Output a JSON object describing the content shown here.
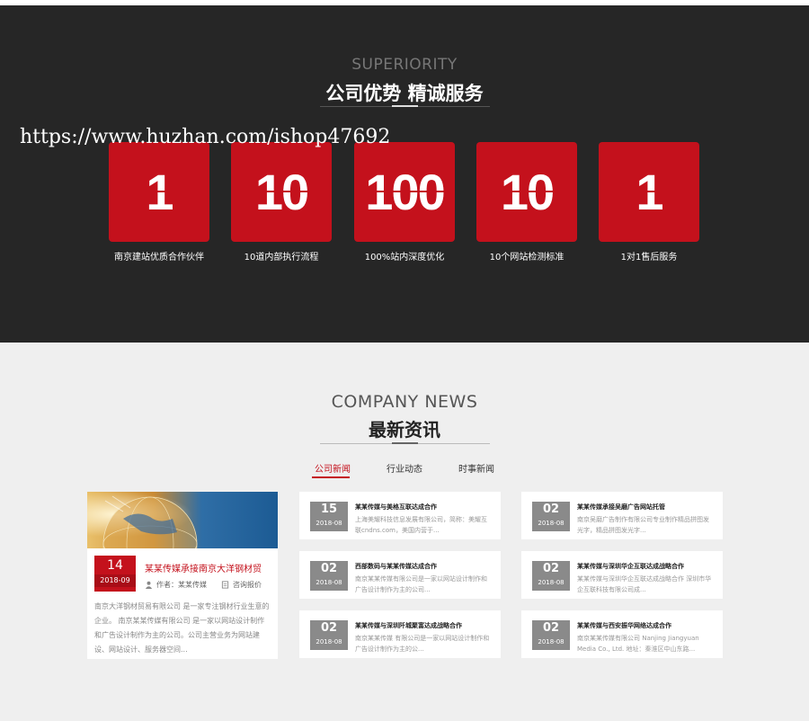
{
  "superiority": {
    "title_en": "SUPERIORITY",
    "title_cn": "公司优势  精诚服务",
    "watermark": "https://www.huzhan.com/ishop47692",
    "items": [
      {
        "number": "1",
        "label": "南京建站优质合作伙伴"
      },
      {
        "number": "10",
        "label": "10道内部执行流程"
      },
      {
        "number": "100",
        "label": "100%站内深度优化"
      },
      {
        "number": "10",
        "label": "10个网站检测标准"
      },
      {
        "number": "1",
        "label": "1对1售后服务"
      }
    ]
  },
  "news": {
    "title_en": "COMPANY NEWS",
    "title_cn": "最新资讯",
    "tabs": [
      "公司新闻",
      "行业动态",
      "时事新闻"
    ],
    "featured": {
      "day": "14",
      "year_month": "2018-09",
      "title": "某某传媒承接南京大洋钢材贸",
      "author": "作者：某某传媒",
      "inquiry": "咨询报价",
      "body": "南京大洋钢材贸易有限公司 是一家专注钢材行业生意的企业。 南京某某传媒有限公司 是一家以网站设计制作和广告设计制作为主的公司。公司主营业务为网站建设、网站设计、服务器空间..."
    },
    "cards": [
      {
        "day": "15",
        "year_month": "2018-08",
        "title": "某某传媒与美格互联达成合作",
        "desc": "上海美耀科技信息发展有限公司，简称：美耀互联cndns.com，美国内营于..."
      },
      {
        "day": "02",
        "year_month": "2018-08",
        "title": "某某传媒承接吴磨广告网站托管",
        "desc": "南京吴磨广告制作有限公司专业制作精品拼图发光字，精品拼图发光字..."
      },
      {
        "day": "02",
        "year_month": "2018-08",
        "title": "西部数码与某某传媒达成合作",
        "desc": "南京某某传媒有限公司是一家以网站设计制作和广告设计制作为主的公司..."
      },
      {
        "day": "02",
        "year_month": "2018-08",
        "title": "某某传媒与深圳华企互联达成战略合作",
        "desc": "某某传媒与深圳华企互联达成战略合作 深圳市华企互联科技有限公司成..."
      },
      {
        "day": "02",
        "year_month": "2018-08",
        "title": "某某传媒与深圳阡城聚富达成战略合作",
        "desc": "南京某某传媒 有限公司是一家以网站设计制作和广告设计制作为主的公..."
      },
      {
        "day": "02",
        "year_month": "2018-08",
        "title": "某某传媒与西安振华网络达成合作",
        "desc": "南京某某传媒有限公司 Nanjing Jiangyuan Media Co., Ltd. 地址：秦淮区中山东路..."
      }
    ]
  }
}
